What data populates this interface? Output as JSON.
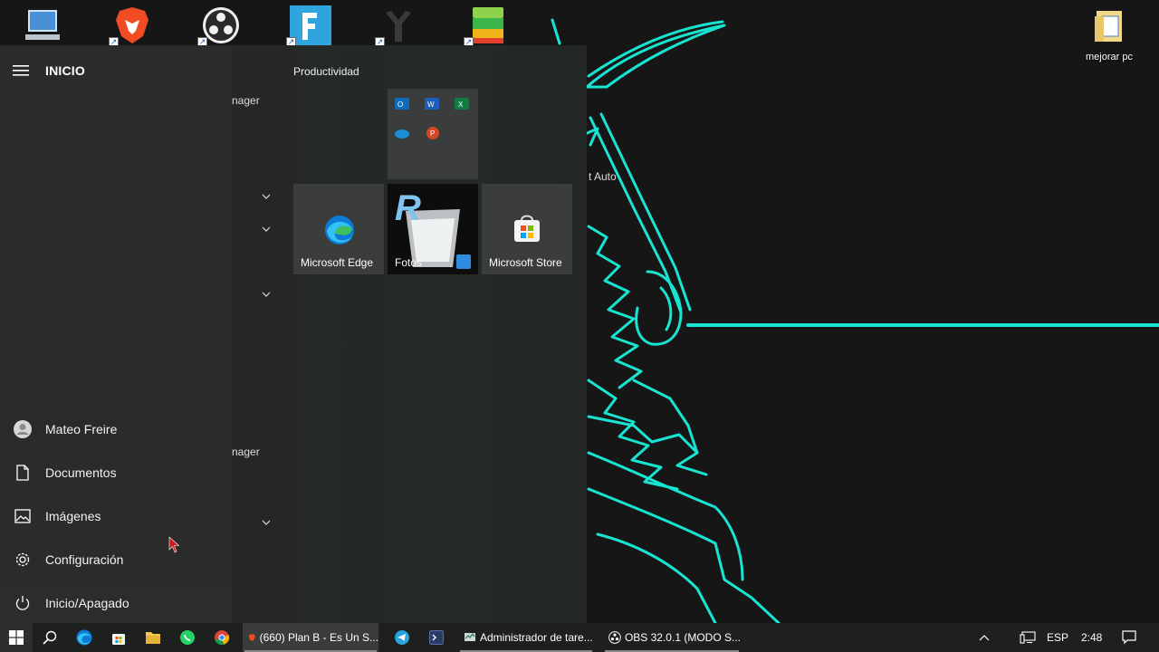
{
  "desktop": {
    "right_icon_label": "mejorar pc",
    "partial_labels": [
      "t Auto"
    ]
  },
  "start_menu": {
    "header_title": "INICIO",
    "applist_fragments": [
      "nager",
      "nager"
    ],
    "side_items": [
      {
        "label": "Mateo Freire",
        "icon": "user-icon"
      },
      {
        "label": "Documentos",
        "icon": "document-icon"
      },
      {
        "label": "Imágenes",
        "icon": "pictures-icon"
      },
      {
        "label": "Configuración",
        "icon": "gear-icon"
      },
      {
        "label": "Inicio/Apagado",
        "icon": "power-icon"
      }
    ],
    "group_title": "Productividad",
    "tiles": {
      "edge": "Microsoft Edge",
      "photos": "Fotos",
      "store": "Microsoft Store"
    }
  },
  "taskbar": {
    "apps": [
      {
        "label": "(660) Plan B - Es Un S..."
      },
      {
        "label": "Administrador de tare..."
      },
      {
        "label": "OBS 32.0.1 (MODO S..."
      }
    ],
    "tray": {
      "language": "ESP",
      "time": "2:48"
    }
  },
  "colors": {
    "accent_cyan": "#18e4d2",
    "taskbar_bg": "#1e1f1f",
    "start_bg": "#242726"
  }
}
